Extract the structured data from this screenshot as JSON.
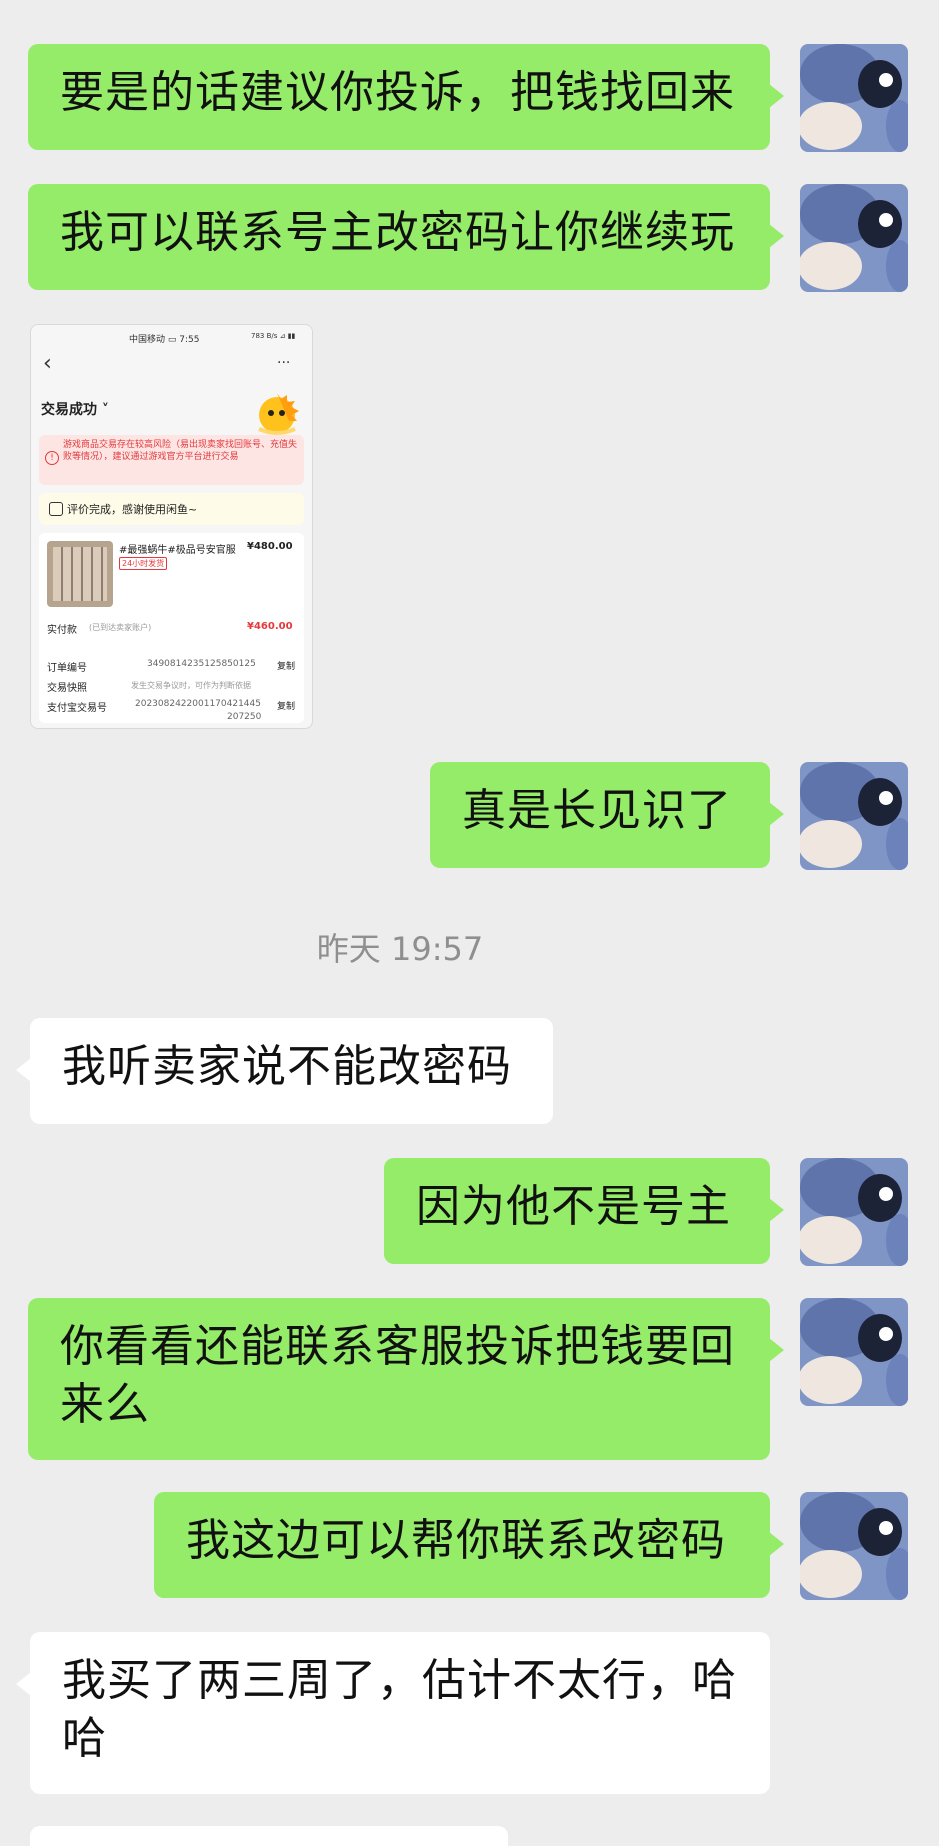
{
  "messages": [
    {
      "side": "me",
      "text": "要是的话建议你投诉，把钱找回来"
    },
    {
      "side": "me",
      "text": "我可以联系号主改密码让你继续玩"
    },
    {
      "side": "me",
      "text": "真是长见识了"
    },
    {
      "side": "other",
      "text": "我听卖家说不能改密码"
    },
    {
      "side": "me",
      "text": "因为他不是号主"
    },
    {
      "side": "me",
      "text": "你看看还能联系客服投诉把钱要回来么"
    },
    {
      "side": "me",
      "text": "我这边可以帮你联系改密码"
    },
    {
      "side": "other",
      "text": "我买了两三周了，估计不太行，哈哈"
    }
  ],
  "timestamp": "昨天 19:57",
  "screenshot": {
    "status_carrier": "中国移动 ▭ 7:55",
    "status_right": "783 B/s ⊿ ▮▮",
    "back": "‹",
    "more": "···",
    "title": "交易成功 ˅",
    "warning": "游戏商品交易存在较高风险（易出现卖家找回账号、充值失败等情况），建议通过游戏官方平台进行交易",
    "review": "评价完成，感谢使用闲鱼~",
    "item_title": "#最强蜗牛#极品号安官服",
    "item_price": "¥480.00",
    "item_badge": "24小时发货",
    "paid_label": "实付款",
    "paid_note": "(已到达卖家账户)",
    "paid_value": "¥460.00",
    "order_label": "订单编号",
    "order_value": "3490814235125850125",
    "copy": "复制",
    "snapshot_label": "交易快照",
    "snapshot_value": "发生交易争议时，可作为判断依据",
    "alipay_label": "支付宝交易号",
    "alipay_value_1": "20230824220011704214​45",
    "alipay_value_2": "207250"
  },
  "colors": {
    "my_bubble": "#95ec69",
    "other_bubble": "#ffffff",
    "background": "#ededed",
    "price_red": "#e4393c"
  }
}
